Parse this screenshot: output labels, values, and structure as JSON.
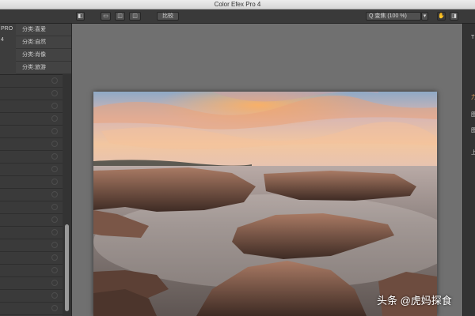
{
  "window": {
    "title": "Color Efex Pro 4"
  },
  "toolbar": {
    "compare_label": "比较",
    "zoom_label": "Q 变焦 (100 %)",
    "zoom_dropdown_glyph": "▾"
  },
  "sidebar": {
    "brand": "PRO 4",
    "categories": [
      {
        "label": "分类:喜爱"
      },
      {
        "label": "分类:自然"
      },
      {
        "label": "分类:肖像"
      },
      {
        "label": "分类:旅游"
      }
    ]
  },
  "right_panel": {
    "letters": [
      "T",
      "力",
      "图",
      "图",
      "上"
    ]
  },
  "watermark": {
    "text": "头条 @虎妈探食"
  },
  "colors": {
    "toolbar": "#3a3a3a",
    "sidebar": "#3d3d3d",
    "canvas": "#707070",
    "accent_orange": "#f0a860"
  }
}
